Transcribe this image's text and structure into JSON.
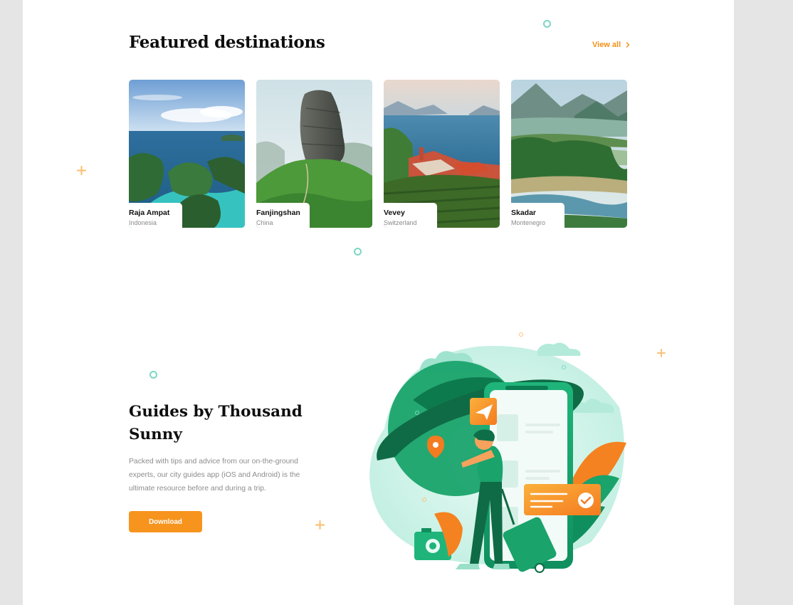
{
  "featured": {
    "title": "Featured destinations",
    "view_all": "View all",
    "destinations": [
      {
        "name": "Raja Ampat",
        "country": "Indonesia"
      },
      {
        "name": "Fanjingshan",
        "country": "China"
      },
      {
        "name": "Vevey",
        "country": "Switzerland"
      },
      {
        "name": "Skadar",
        "country": "Montenegro"
      }
    ]
  },
  "guides": {
    "title": "Guides by Thousand Sunny",
    "description": "Packed with tips and advice from our on-the-ground experts, our city guides app (iOS and Android) is the ultimate resource before and during a trip.",
    "download_label": "Download"
  },
  "icons": {
    "view_all_arrow": "chevron-right-icon",
    "plus": "plus-icon",
    "circle": "circle-icon"
  },
  "colors": {
    "accent": "#f7941d",
    "green": "#1aa36b",
    "teal": "#5ccfb5",
    "text_dark": "#0e0e0e",
    "text_muted": "#8d8d8d"
  }
}
